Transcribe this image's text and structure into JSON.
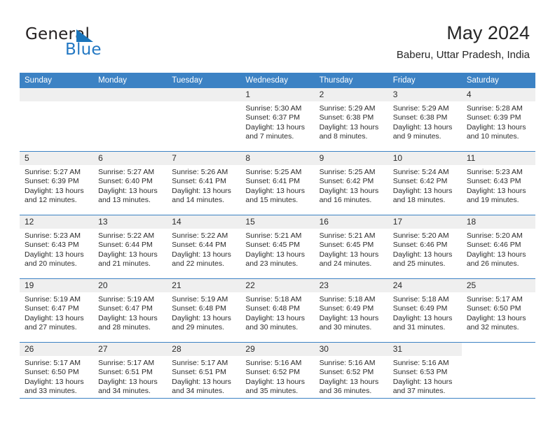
{
  "brand": {
    "word_one": "General",
    "word_two": "Blue",
    "accent_color": "#1b75bb"
  },
  "header": {
    "month_title": "May 2024",
    "location": "Baberu, Uttar Pradesh, India"
  },
  "calendar": {
    "header_bg": "#3c82c4",
    "daynum_bg": "#efefef",
    "weekday_headers": [
      "Sunday",
      "Monday",
      "Tuesday",
      "Wednesday",
      "Thursday",
      "Friday",
      "Saturday"
    ],
    "weeks": [
      [
        {
          "day": "",
          "lines": []
        },
        {
          "day": "",
          "lines": []
        },
        {
          "day": "",
          "lines": []
        },
        {
          "day": "1",
          "lines": [
            "Sunrise: 5:30 AM",
            "Sunset: 6:37 PM",
            "Daylight: 13 hours",
            "and 7 minutes."
          ]
        },
        {
          "day": "2",
          "lines": [
            "Sunrise: 5:29 AM",
            "Sunset: 6:38 PM",
            "Daylight: 13 hours",
            "and 8 minutes."
          ]
        },
        {
          "day": "3",
          "lines": [
            "Sunrise: 5:29 AM",
            "Sunset: 6:38 PM",
            "Daylight: 13 hours",
            "and 9 minutes."
          ]
        },
        {
          "day": "4",
          "lines": [
            "Sunrise: 5:28 AM",
            "Sunset: 6:39 PM",
            "Daylight: 13 hours",
            "and 10 minutes."
          ]
        }
      ],
      [
        {
          "day": "5",
          "lines": [
            "Sunrise: 5:27 AM",
            "Sunset: 6:39 PM",
            "Daylight: 13 hours",
            "and 12 minutes."
          ]
        },
        {
          "day": "6",
          "lines": [
            "Sunrise: 5:27 AM",
            "Sunset: 6:40 PM",
            "Daylight: 13 hours",
            "and 13 minutes."
          ]
        },
        {
          "day": "7",
          "lines": [
            "Sunrise: 5:26 AM",
            "Sunset: 6:41 PM",
            "Daylight: 13 hours",
            "and 14 minutes."
          ]
        },
        {
          "day": "8",
          "lines": [
            "Sunrise: 5:25 AM",
            "Sunset: 6:41 PM",
            "Daylight: 13 hours",
            "and 15 minutes."
          ]
        },
        {
          "day": "9",
          "lines": [
            "Sunrise: 5:25 AM",
            "Sunset: 6:42 PM",
            "Daylight: 13 hours",
            "and 16 minutes."
          ]
        },
        {
          "day": "10",
          "lines": [
            "Sunrise: 5:24 AM",
            "Sunset: 6:42 PM",
            "Daylight: 13 hours",
            "and 18 minutes."
          ]
        },
        {
          "day": "11",
          "lines": [
            "Sunrise: 5:23 AM",
            "Sunset: 6:43 PM",
            "Daylight: 13 hours",
            "and 19 minutes."
          ]
        }
      ],
      [
        {
          "day": "12",
          "lines": [
            "Sunrise: 5:23 AM",
            "Sunset: 6:43 PM",
            "Daylight: 13 hours",
            "and 20 minutes."
          ]
        },
        {
          "day": "13",
          "lines": [
            "Sunrise: 5:22 AM",
            "Sunset: 6:44 PM",
            "Daylight: 13 hours",
            "and 21 minutes."
          ]
        },
        {
          "day": "14",
          "lines": [
            "Sunrise: 5:22 AM",
            "Sunset: 6:44 PM",
            "Daylight: 13 hours",
            "and 22 minutes."
          ]
        },
        {
          "day": "15",
          "lines": [
            "Sunrise: 5:21 AM",
            "Sunset: 6:45 PM",
            "Daylight: 13 hours",
            "and 23 minutes."
          ]
        },
        {
          "day": "16",
          "lines": [
            "Sunrise: 5:21 AM",
            "Sunset: 6:45 PM",
            "Daylight: 13 hours",
            "and 24 minutes."
          ]
        },
        {
          "day": "17",
          "lines": [
            "Sunrise: 5:20 AM",
            "Sunset: 6:46 PM",
            "Daylight: 13 hours",
            "and 25 minutes."
          ]
        },
        {
          "day": "18",
          "lines": [
            "Sunrise: 5:20 AM",
            "Sunset: 6:46 PM",
            "Daylight: 13 hours",
            "and 26 minutes."
          ]
        }
      ],
      [
        {
          "day": "19",
          "lines": [
            "Sunrise: 5:19 AM",
            "Sunset: 6:47 PM",
            "Daylight: 13 hours",
            "and 27 minutes."
          ]
        },
        {
          "day": "20",
          "lines": [
            "Sunrise: 5:19 AM",
            "Sunset: 6:47 PM",
            "Daylight: 13 hours",
            "and 28 minutes."
          ]
        },
        {
          "day": "21",
          "lines": [
            "Sunrise: 5:19 AM",
            "Sunset: 6:48 PM",
            "Daylight: 13 hours",
            "and 29 minutes."
          ]
        },
        {
          "day": "22",
          "lines": [
            "Sunrise: 5:18 AM",
            "Sunset: 6:48 PM",
            "Daylight: 13 hours",
            "and 30 minutes."
          ]
        },
        {
          "day": "23",
          "lines": [
            "Sunrise: 5:18 AM",
            "Sunset: 6:49 PM",
            "Daylight: 13 hours",
            "and 30 minutes."
          ]
        },
        {
          "day": "24",
          "lines": [
            "Sunrise: 5:18 AM",
            "Sunset: 6:49 PM",
            "Daylight: 13 hours",
            "and 31 minutes."
          ]
        },
        {
          "day": "25",
          "lines": [
            "Sunrise: 5:17 AM",
            "Sunset: 6:50 PM",
            "Daylight: 13 hours",
            "and 32 minutes."
          ]
        }
      ],
      [
        {
          "day": "26",
          "lines": [
            "Sunrise: 5:17 AM",
            "Sunset: 6:50 PM",
            "Daylight: 13 hours",
            "and 33 minutes."
          ]
        },
        {
          "day": "27",
          "lines": [
            "Sunrise: 5:17 AM",
            "Sunset: 6:51 PM",
            "Daylight: 13 hours",
            "and 34 minutes."
          ]
        },
        {
          "day": "28",
          "lines": [
            "Sunrise: 5:17 AM",
            "Sunset: 6:51 PM",
            "Daylight: 13 hours",
            "and 34 minutes."
          ]
        },
        {
          "day": "29",
          "lines": [
            "Sunrise: 5:16 AM",
            "Sunset: 6:52 PM",
            "Daylight: 13 hours",
            "and 35 minutes."
          ]
        },
        {
          "day": "30",
          "lines": [
            "Sunrise: 5:16 AM",
            "Sunset: 6:52 PM",
            "Daylight: 13 hours",
            "and 36 minutes."
          ]
        },
        {
          "day": "31",
          "lines": [
            "Sunrise: 5:16 AM",
            "Sunset: 6:53 PM",
            "Daylight: 13 hours",
            "and 37 minutes."
          ]
        },
        {
          "day": "",
          "lines": []
        }
      ]
    ]
  }
}
